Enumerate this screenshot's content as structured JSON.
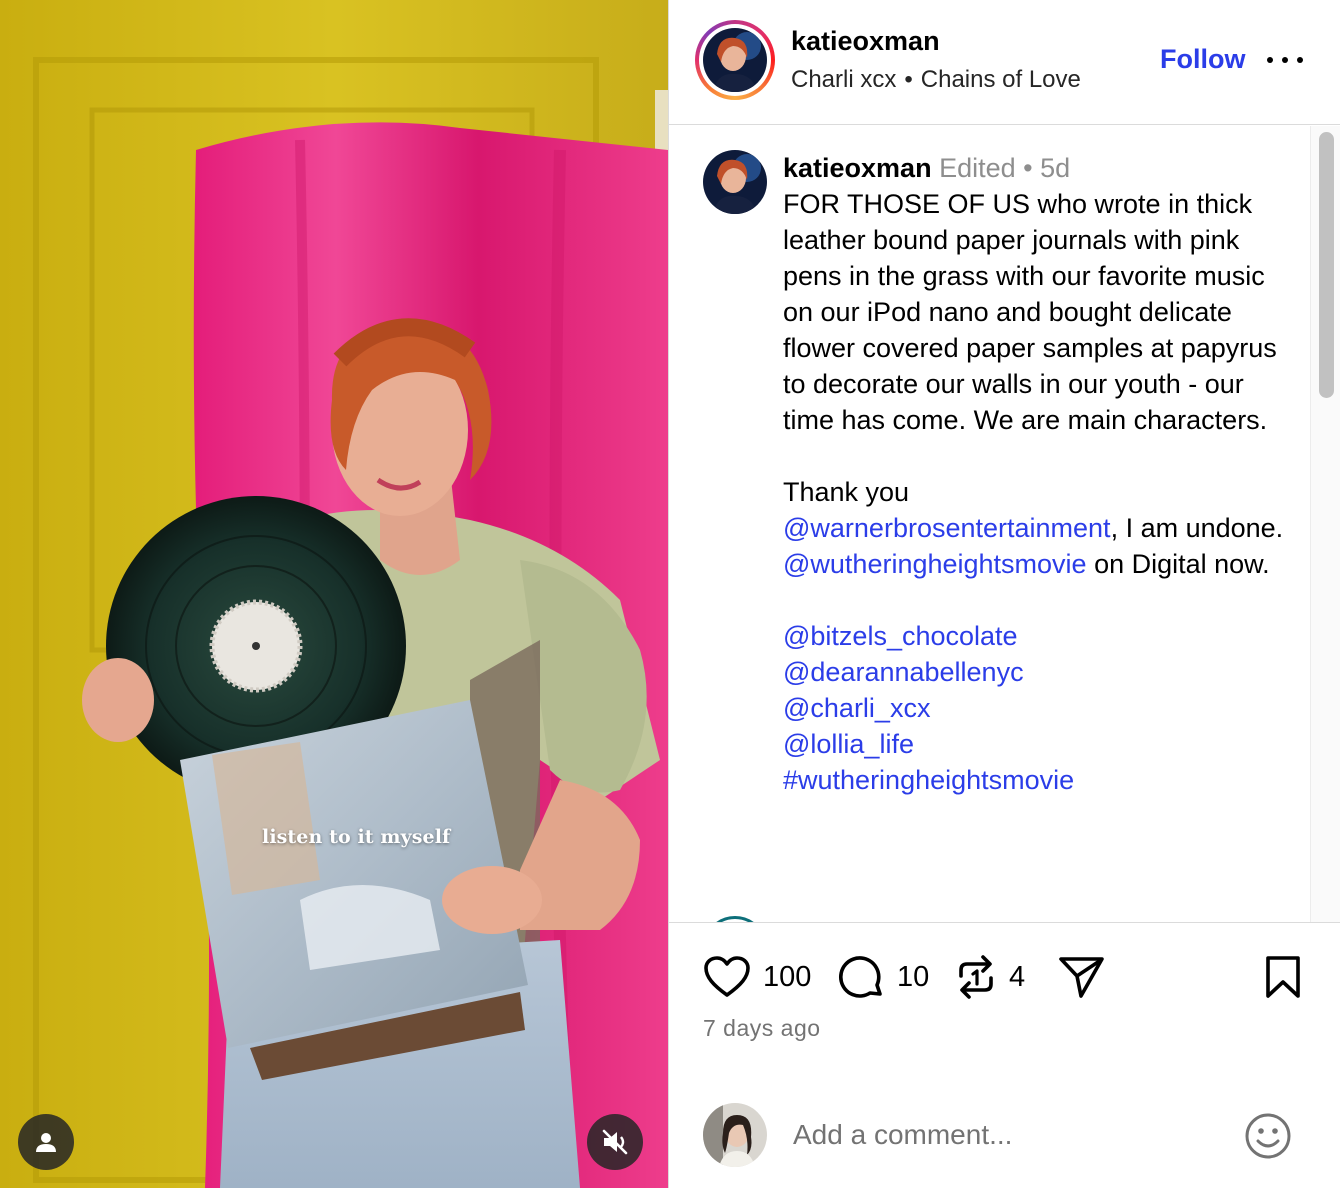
{
  "media": {
    "caption": "listen to it myself",
    "user_tag_icon": "user-icon",
    "mute_icon": "speaker-muted-icon"
  },
  "header": {
    "username": "katieoxman",
    "audio_artist": "Charli xcx",
    "separator": "•",
    "audio_track": "Chains of Love",
    "follow_label": "Follow",
    "more_icon": "more-options-icon"
  },
  "caption_comment": {
    "username": "katieoxman",
    "edited": "Edited",
    "dot": "•",
    "age": "5d",
    "para1": "FOR THOSE OF US who wrote in thick leather bound paper journals with pink pens in the grass with our favorite music on our iPod nano and bought delicate flower covered paper samples at papyrus to decorate our walls in our youth - our time has come. We are main characters.",
    "thank_you": "Thank you",
    "mention_wb": "@warnerbrosentertainment",
    "after_wb": ", I am undone. ",
    "mention_wh": "@wutheringheightsmovie",
    "after_wh": " on Digital now.",
    "tags": [
      "@bitzels_chocolate",
      "@dearannabellenyc",
      "@charli_xcx",
      "@lollia_life",
      "#wutheringheightsmovie"
    ]
  },
  "actions": {
    "like_count": "100",
    "comment_count": "10",
    "repost_count": "4",
    "timestamp": "7 days ago"
  },
  "add_comment": {
    "placeholder": "Add a comment..."
  },
  "colors": {
    "link_blue": "#2b3de8",
    "muted_text": "#737373",
    "border": "#dbdbdb"
  }
}
